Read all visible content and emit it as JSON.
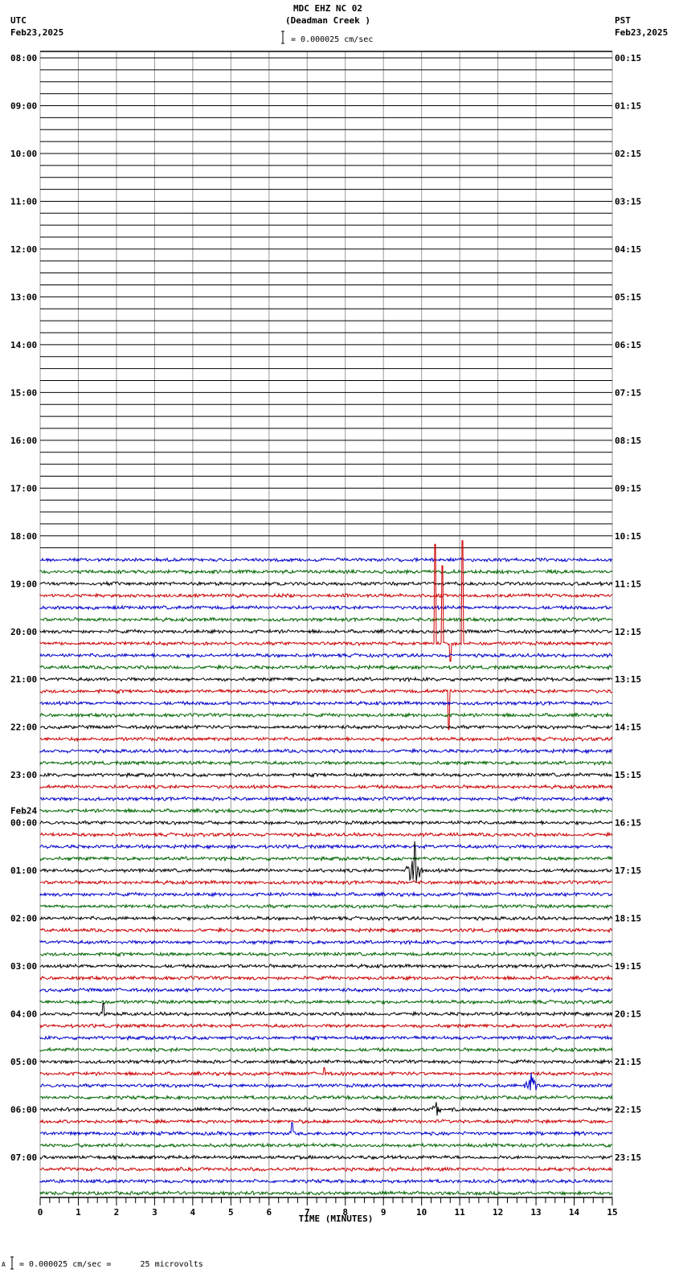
{
  "header": {
    "title": "MDC EHZ NC 02",
    "subtitle": "(Deadman Creek )",
    "left_tz": "UTC",
    "left_date": "Feb23,2025",
    "right_tz": "PST",
    "right_date": "Feb23,2025",
    "scale_text": "= 0.000025 cm/sec"
  },
  "footer": {
    "scale_text": "= 0.000025 cm/sec =      25 microvolts",
    "prefix": "A"
  },
  "chart_data": {
    "type": "line",
    "title": "MDC EHZ NC 02 (Deadman Creek )",
    "xlabel": "TIME (MINUTES)",
    "xlim": [
      0,
      15
    ],
    "x_ticks": [
      "0",
      "1",
      "2",
      "3",
      "4",
      "5",
      "6",
      "7",
      "8",
      "9",
      "10",
      "11",
      "12",
      "13",
      "14",
      "15"
    ],
    "minor_tick_step": 0.25,
    "grid": true,
    "rows_per_hour": 4,
    "left_labels": [
      "08:00",
      "09:00",
      "10:00",
      "11:00",
      "12:00",
      "13:00",
      "14:00",
      "15:00",
      "16:00",
      "17:00",
      "18:00",
      "19:00",
      "20:00",
      "21:00",
      "22:00",
      "23:00",
      "00:00",
      "01:00",
      "02:00",
      "03:00",
      "04:00",
      "05:00",
      "06:00",
      "07:00"
    ],
    "date_change_label": "Feb24",
    "date_change_hour_index": 16,
    "right_labels": [
      "00:15",
      "01:15",
      "02:15",
      "03:15",
      "04:15",
      "05:15",
      "06:15",
      "07:15",
      "08:15",
      "09:15",
      "10:15",
      "11:15",
      "12:15",
      "13:15",
      "14:15",
      "15:15",
      "16:15",
      "17:15",
      "18:15",
      "19:15",
      "20:15",
      "21:15",
      "22:15",
      "23:15"
    ],
    "trace_colors": [
      "#000000",
      "#cc0000",
      "#0000cc",
      "#006600"
    ],
    "total_rows": 96,
    "first_data_row": 42,
    "noise_level": 0.12,
    "events": [
      {
        "row": 49,
        "minute": 10.35,
        "amplitude": 8.3,
        "shape": "spike"
      },
      {
        "row": 49,
        "minute": 10.55,
        "amplitude": 6.5,
        "shape": "spike"
      },
      {
        "row": 49,
        "minute": 11.08,
        "amplitude": 8.6,
        "shape": "spike"
      },
      {
        "row": 49,
        "minute": 10.75,
        "amplitude": -1.5,
        "shape": "spike"
      },
      {
        "row": 53,
        "minute": 10.72,
        "amplitude": -3.2,
        "shape": "spike"
      },
      {
        "row": 68,
        "minute": 9.8,
        "amplitude": 3.0,
        "shape": "burst"
      },
      {
        "row": 80,
        "minute": 1.65,
        "amplitude": 0.9,
        "shape": "spike"
      },
      {
        "row": 86,
        "minute": 12.87,
        "amplitude": 1.3,
        "shape": "burst"
      },
      {
        "row": 88,
        "minute": 10.4,
        "amplitude": 0.8,
        "shape": "burst"
      },
      {
        "row": 90,
        "minute": 6.6,
        "amplitude": 0.9,
        "shape": "spike"
      },
      {
        "row": 85,
        "minute": 7.45,
        "amplitude": 0.5,
        "shape": "spike"
      }
    ]
  }
}
